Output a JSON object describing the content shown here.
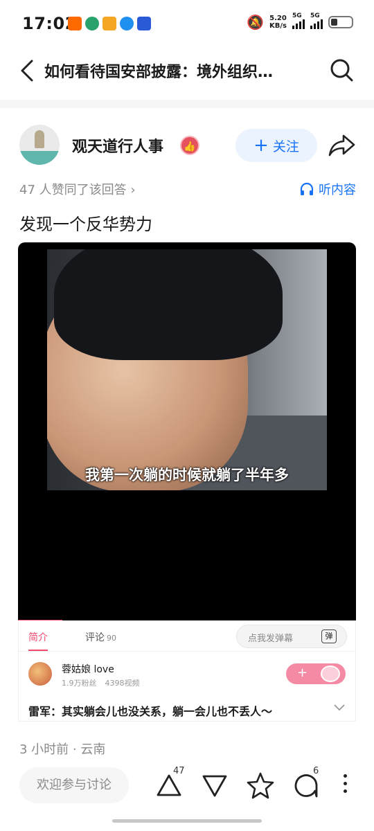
{
  "status_bar": {
    "time": "17:02",
    "speed_value": "5.20",
    "speed_unit": "KB/s",
    "network_1": "5G",
    "network_2": "5G",
    "app_icon_colors": [
      "#ff6a00",
      "#2aa26b",
      "#f5a623",
      "#1f8ff0",
      "#2a5bd7"
    ]
  },
  "header": {
    "title": "如何看待国安部披露：境外组织…"
  },
  "author": {
    "name": "观天道行人事",
    "follow_label": "关注"
  },
  "answer_meta": {
    "likes_text": "47 人赞同了该回答 ›",
    "listen_label": "听内容"
  },
  "answer_text": "发现一个反华势力",
  "video": {
    "caption": "我第一次躺的时候就躺了半年多",
    "tabs": {
      "intro": "简介",
      "comments": "评论",
      "comments_count": "90"
    },
    "danmaku_placeholder": "点我发弹幕",
    "danmaku_icon_text": "弹",
    "uploader": {
      "name": "蓉姑娘 love",
      "fans": "1.9万粉丝",
      "videos": "4398视频"
    },
    "follow_plus": "+",
    "title": "雷军：其实躺会儿也没关系，躺一会儿也不丢人～"
  },
  "post_meta": "3 小时前 · 云南",
  "bottom_bar": {
    "discuss_placeholder": "欢迎参与讨论",
    "upvote_count": "47",
    "comment_count": "6"
  },
  "colors": {
    "accent_blue": "#1772f6",
    "video_pink": "#f0486e"
  }
}
